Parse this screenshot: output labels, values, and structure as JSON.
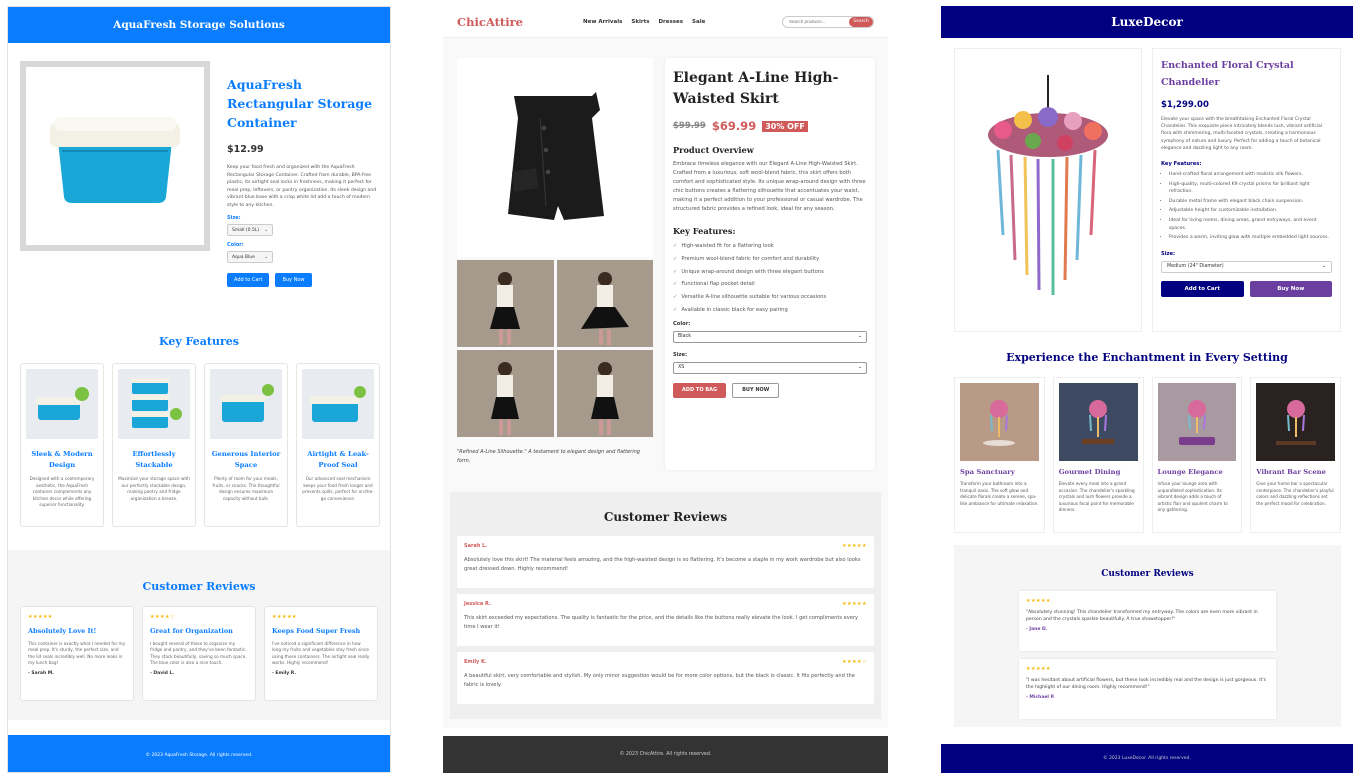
{
  "aquafresh": {
    "header_title": "AquaFresh Storage Solutions",
    "product_title": "AquaFresh Rectangular Storage Container",
    "price": "$12.99",
    "description": "Keep your food fresh and organized with the AquaFresh Rectangular Storage Container. Crafted from durable, BPA-free plastic, its airtight seal locks in freshness, making it perfect for meal prep, leftovers, or pantry organization. Its sleek design and vibrant blue base with a crisp white lid add a touch of modern style to any kitchen.",
    "size_label": "Size:",
    "size_value": "Small (0.5L)",
    "color_label": "Color:",
    "color_value": "Aqua Blue",
    "add_to_cart": "Add to Cart",
    "buy_now": "Buy Now",
    "features_title": "Key Features",
    "features": [
      {
        "title": "Sleek & Modern Design",
        "text": "Designed with a contemporary aesthetic, the AquaFresh container complements any kitchen decor while offering superior functionality."
      },
      {
        "title": "Effortlessly Stackable",
        "text": "Maximize your storage space with our perfectly stackable design, making pantry and fridge organization a breeze."
      },
      {
        "title": "Generous Interior Space",
        "text": "Plenty of room for your meals, fruits, or snacks. The thoughtful design ensures maximum capacity without bulk."
      },
      {
        "title": "Airtight & Leak-Proof Seal",
        "text": "Our advanced seal mechanism keeps your food fresh longer and prevents spills, perfect for on-the-go convenience."
      }
    ],
    "reviews_title": "Customer Reviews",
    "reviews": [
      {
        "stars": "★★★★★",
        "title": "Absolutely Love It!",
        "text": "This container is exactly what I needed for my meal prep. It's sturdy, the perfect size, and the lid seals incredibly well. No more leaks in my lunch bag!",
        "author": "- Sarah M."
      },
      {
        "stars": "★★★★☆",
        "title": "Great for Organization",
        "text": "I bought several of these to organize my fridge and pantry, and they've been fantastic. They stack beautifully, saving so much space. The blue color is also a nice touch.",
        "author": "- David L."
      },
      {
        "stars": "★★★★★",
        "title": "Keeps Food Super Fresh",
        "text": "I've noticed a significant difference in how long my fruits and vegetables stay fresh since using these containers. The airtight seal really works. Highly recommend!",
        "author": "- Emily R."
      }
    ],
    "footer": "© 2023 AquaFresh Storage. All rights reserved.",
    "accent": "#0a7dff"
  },
  "chicattire": {
    "logo": "ChicAttire",
    "nav": [
      "New Arrivals",
      "Skirts",
      "Dresses",
      "Sale"
    ],
    "search_placeholder": "Search products...",
    "search_button": "Search",
    "product_title": "Elegant A-Line High-Waisted Skirt",
    "old_price": "$99.99",
    "new_price": "$69.99",
    "discount": "30% OFF",
    "overview_title": "Product Overview",
    "overview": "Embrace timeless elegance with our Elegant A-Line High-Waisted Skirt. Crafted from a luxurious, soft wool-blend fabric, this skirt offers both comfort and sophisticated style. Its unique wrap-around design with three chic buttons creates a flattering silhouette that accentuates your waist, making it a perfect addition to your professional or casual wardrobe. The structured fabric provides a refined look, ideal for any season.",
    "features_title": "Key Features:",
    "features": [
      "High-waisted fit for a flattering look",
      "Premium wool-blend fabric for comfort and durability",
      "Unique wrap-around design with three elegant buttons",
      "Functional flap pocket detail",
      "Versatile A-line silhouette suitable for various occasions",
      "Available in classic black for easy pairing"
    ],
    "color_label": "Color:",
    "color_value": "Black",
    "size_label": "Size:",
    "size_value": "XS",
    "add_to_bag": "ADD TO BAG",
    "buy_now": "BUY NOW",
    "caption": "\"Refined A-Line Silhouette.\" A testament to elegant design and flattering form.",
    "reviews_title": "Customer Reviews",
    "reviews": [
      {
        "name": "Sarah L.",
        "stars": "★★★★★",
        "text": "Absolutely love this skirt! The material feels amazing, and the high-waisted design is so flattering. It's become a staple in my work wardrobe but also looks great dressed down. Highly recommend!"
      },
      {
        "name": "Jessica R.",
        "stars": "★★★★★",
        "text": "This skirt exceeded my expectations. The quality is fantastic for the price, and the details like the buttons really elevate the look. I get compliments every time I wear it!"
      },
      {
        "name": "Emily K.",
        "stars": "★★★★☆",
        "text": "A beautiful skirt, very comfortable and stylish. My only minor suggestion would be for more color options, but the black is classic. It fits perfectly and the fabric is lovely."
      }
    ],
    "footer": "© 2023 ChicAttire. All rights reserved.",
    "accent": "#d05a5a"
  },
  "luxedecor": {
    "header_title": "LuxeDecor",
    "product_title": "Enchanted Floral Crystal Chandelier",
    "price": "$1,299.00",
    "description": "Elevate your space with the breathtaking Enchanted Floral Crystal Chandelier. This exquisite piece intricately blends lush, vibrant artificial flora with shimmering, multi-faceted crystals, creating a harmonious symphony of nature and luxury. Perfect for adding a touch of botanical elegance and dazzling light to any room.",
    "features_title": "Key Features:",
    "features": [
      "Hand-crafted floral arrangement with realistic silk flowers.",
      "High-quality, multi-colored K9 crystal prisms for brilliant light refraction.",
      "Durable metal frame with elegant black chain suspension.",
      "Adjustable height for customizable installation.",
      "Ideal for living rooms, dining areas, grand entryways, and event spaces.",
      "Provides a warm, inviting glow with multiple embedded light sources."
    ],
    "size_label": "Size:",
    "size_value": "Medium (24\" Diameter)",
    "add_to_cart": "Add to Cart",
    "buy_now": "Buy Now",
    "experience_title": "Experience the Enchantment in Every Setting",
    "settings": [
      {
        "title": "Spa Sanctuary",
        "text": "Transform your bathroom into a tranquil oasis. The soft glow and delicate florals create a serene, spa-like ambiance for ultimate relaxation."
      },
      {
        "title": "Gourmet Dining",
        "text": "Elevate every meal into a grand occasion. The chandelier's sparkling crystals and lush flowers provide a luxurious focal point for memorable dinners."
      },
      {
        "title": "Lounge Elegance",
        "text": "Infuse your lounge area with unparalleled sophistication. Its vibrant design adds a touch of artistic flair and opulent charm to any gathering."
      },
      {
        "title": "Vibrant Bar Scene",
        "text": "Give your home bar a spectacular centerpiece. The chandelier's playful colors and dazzling reflections set the perfect mood for celebration."
      }
    ],
    "reviews_title": "Customer Reviews",
    "reviews": [
      {
        "stars": "★★★★★",
        "text": "\"Absolutely stunning! This chandelier transformed my entryway. The colors are even more vibrant in person and the crystals sparkle beautifully. A true showstopper!\"",
        "author": "- Jane D."
      },
      {
        "stars": "★★★★★",
        "text": "\"I was hesitant about artificial flowers, but these look incredibly real and the design is just gorgeous. It's the highlight of our dining room. Highly recommend!\"",
        "author": "- Michael P."
      }
    ],
    "footer": "© 2023 LuxeDecor. All rights reserved.",
    "accent": "#000080",
    "accent2": "#6b3fa0"
  }
}
